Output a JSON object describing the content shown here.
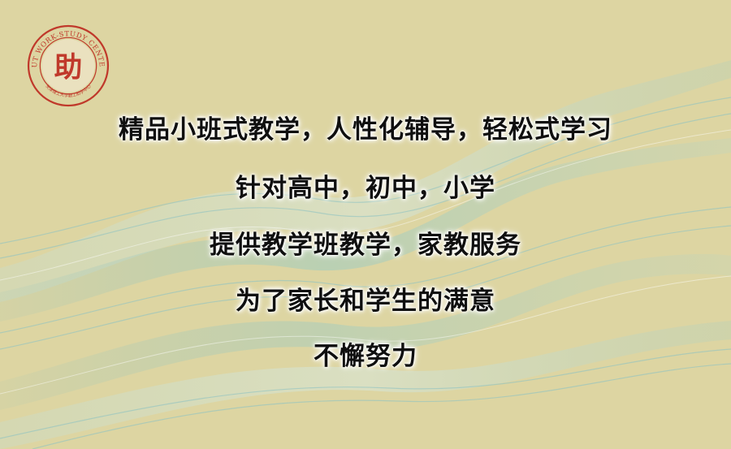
{
  "logo": {
    "ring_text": "TUT WORK-STUDY CENTER",
    "inner_text": "天津理工大学勤工助学中心",
    "glyph": "助",
    "color": "#c0392b"
  },
  "slogan": {
    "line1": "精品小班式教学，人性化辅导，轻松式学习",
    "line2": "针对高中，初中，小学",
    "line3": "提供教学班教学，家教服务",
    "line4": "为了家长和学生的满意",
    "line5": "不懈努力"
  },
  "colors": {
    "background": "#ddd5a2",
    "wave": "#8fc4c4",
    "text": "#0f0f0f"
  }
}
